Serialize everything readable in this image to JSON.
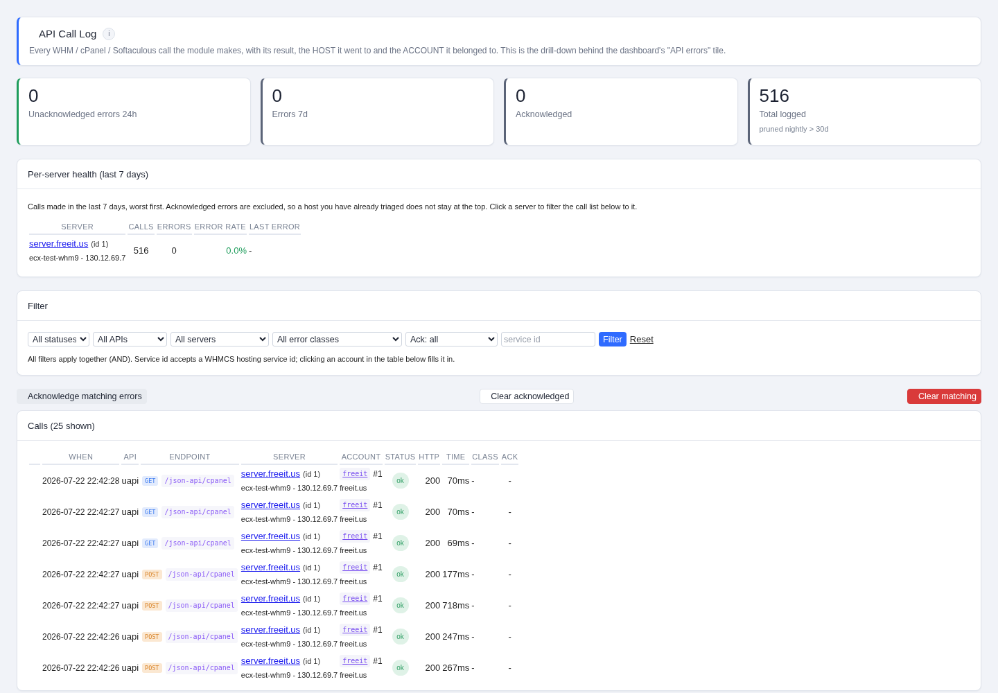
{
  "header": {
    "title": "API Call Log",
    "info": "i",
    "description": "Every WHM / cPanel / Softaculous call the module makes, with its result, the HOST it went to and the ACCOUNT it belonged to. This is the drill-down behind the dashboard's \"API errors\" tile."
  },
  "stats": [
    {
      "value": "0",
      "label": "Unacknowledged errors 24h",
      "kind": "success"
    },
    {
      "value": "0",
      "label": "Errors 7d",
      "kind": "neutral"
    },
    {
      "value": "0",
      "label": "Acknowledged",
      "kind": "neutral"
    },
    {
      "value": "516",
      "label": "Total logged",
      "note": "pruned nightly > 30d",
      "kind": "neutral"
    }
  ],
  "server_health": {
    "title": "Per-server health (last 7 days)",
    "description": "Calls made in the last 7 days, worst first. Acknowledged errors are excluded, so a host you have already triaged does not stay at the top. Click a server to filter the call list below to it.",
    "columns": [
      "SERVER",
      "CALLS",
      "ERRORS",
      "ERROR RATE",
      "LAST ERROR"
    ],
    "rows": [
      {
        "server": "server.freeit.us",
        "server_id": "(id 1)",
        "host": "ecx-test-whm9 - 130.12.69.7",
        "calls": "516",
        "errors": "0",
        "error_rate": {
          "text": "0.0%",
          "kind": "good"
        },
        "last_error": "-"
      }
    ]
  },
  "filter": {
    "title": "Filter",
    "selects": [
      "All statuses",
      "All APIs",
      "All servers",
      "All error classes",
      "Ack: all"
    ],
    "service_id": {
      "placeholder": "service id"
    },
    "submit": "Filter",
    "reset": "Reset",
    "help": "All filters apply together (AND). Service id accepts a WHMCS hosting service id; clicking an account in the table below fills it in."
  },
  "actions": [
    {
      "label": "Acknowledge matching errors",
      "kind": "secondary"
    },
    {
      "label": "Clear acknowledged",
      "kind": "outline"
    },
    {
      "label": "Clear matching",
      "kind": "danger"
    }
  ],
  "calls": {
    "title": "Calls (25 shown)",
    "columns": [
      "WHEN",
      "API",
      "ENDPOINT",
      "SERVER",
      "ACCOUNT",
      "STATUS",
      "HTTP",
      "TIME",
      "CLASS",
      "ACK"
    ],
    "rows": [
      {
        "when": "2026-07-22 22:42:28",
        "api": "uapi",
        "method": {
          "label": "GET",
          "kind": "get"
        },
        "endpoint": "/json-api/cpanel",
        "server": "server.freeit.us",
        "server_id": "(id 1)",
        "host": "ecx-test-whm9 - 130.12.69.7",
        "account": "freeit",
        "service": "#1",
        "domain": "freeit.us",
        "status": {
          "label": "ok",
          "kind": "ok"
        },
        "http": "200",
        "time": "70ms",
        "class": "-",
        "ack": "-"
      },
      {
        "when": "2026-07-22 22:42:27",
        "api": "uapi",
        "method": {
          "label": "GET",
          "kind": "get"
        },
        "endpoint": "/json-api/cpanel",
        "server": "server.freeit.us",
        "server_id": "(id 1)",
        "host": "ecx-test-whm9 - 130.12.69.7",
        "account": "freeit",
        "service": "#1",
        "domain": "freeit.us",
        "status": {
          "label": "ok",
          "kind": "ok"
        },
        "http": "200",
        "time": "70ms",
        "class": "-",
        "ack": "-"
      },
      {
        "when": "2026-07-22 22:42:27",
        "api": "uapi",
        "method": {
          "label": "GET",
          "kind": "get"
        },
        "endpoint": "/json-api/cpanel",
        "server": "server.freeit.us",
        "server_id": "(id 1)",
        "host": "ecx-test-whm9 - 130.12.69.7",
        "account": "freeit",
        "service": "#1",
        "domain": "freeit.us",
        "status": {
          "label": "ok",
          "kind": "ok"
        },
        "http": "200",
        "time": "69ms",
        "class": "-",
        "ack": "-"
      },
      {
        "when": "2026-07-22 22:42:27",
        "api": "uapi",
        "method": {
          "label": "POST",
          "kind": "post"
        },
        "endpoint": "/json-api/cpanel",
        "server": "server.freeit.us",
        "server_id": "(id 1)",
        "host": "ecx-test-whm9 - 130.12.69.7",
        "account": "freeit",
        "service": "#1",
        "domain": "freeit.us",
        "status": {
          "label": "ok",
          "kind": "ok"
        },
        "http": "200",
        "time": "177ms",
        "class": "-",
        "ack": "-"
      },
      {
        "when": "2026-07-22 22:42:27",
        "api": "uapi",
        "method": {
          "label": "POST",
          "kind": "post"
        },
        "endpoint": "/json-api/cpanel",
        "server": "server.freeit.us",
        "server_id": "(id 1)",
        "host": "ecx-test-whm9 - 130.12.69.7",
        "account": "freeit",
        "service": "#1",
        "domain": "freeit.us",
        "status": {
          "label": "ok",
          "kind": "ok"
        },
        "http": "200",
        "time": "718ms",
        "class": "-",
        "ack": "-"
      },
      {
        "when": "2026-07-22 22:42:26",
        "api": "uapi",
        "method": {
          "label": "POST",
          "kind": "post"
        },
        "endpoint": "/json-api/cpanel",
        "server": "server.freeit.us",
        "server_id": "(id 1)",
        "host": "ecx-test-whm9 - 130.12.69.7",
        "account": "freeit",
        "service": "#1",
        "domain": "freeit.us",
        "status": {
          "label": "ok",
          "kind": "ok"
        },
        "http": "200",
        "time": "247ms",
        "class": "-",
        "ack": "-"
      },
      {
        "when": "2026-07-22 22:42:26",
        "api": "uapi",
        "method": {
          "label": "POST",
          "kind": "post"
        },
        "endpoint": "/json-api/cpanel",
        "server": "server.freeit.us",
        "server_id": "(id 1)",
        "host": "ecx-test-whm9 - 130.12.69.7",
        "account": "freeit",
        "service": "#1",
        "domain": "freeit.us",
        "status": {
          "label": "ok",
          "kind": "ok"
        },
        "http": "200",
        "time": "267ms",
        "class": "-",
        "ack": "-"
      }
    ]
  }
}
